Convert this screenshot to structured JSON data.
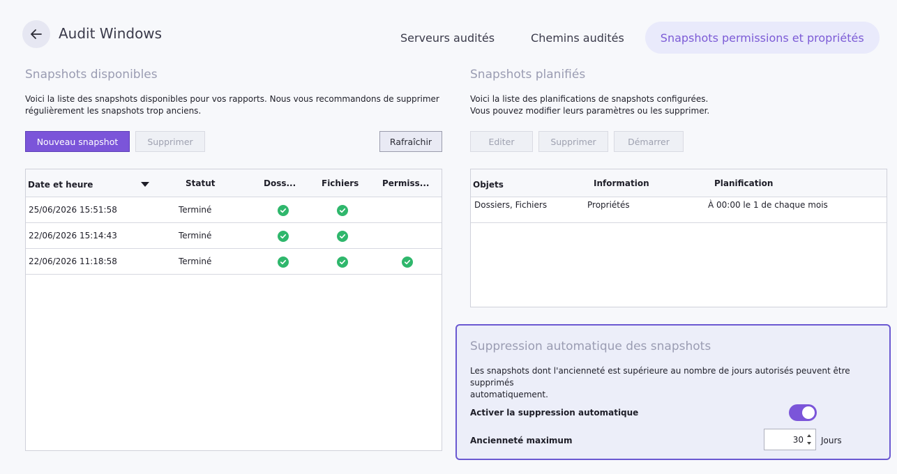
{
  "header": {
    "title": "Audit Windows",
    "tabs": [
      {
        "label": "Serveurs audités",
        "active": false
      },
      {
        "label": "Chemins audités",
        "active": false
      },
      {
        "label": "Snapshots permissions et propriétés",
        "active": true
      }
    ]
  },
  "snapshots": {
    "title": "Snapshots disponibles",
    "desc_line1": "Voici la liste des snapshots disponibles pour vos rapports. Nous vous recommandons de supprimer",
    "desc_line2": "régulièrement les snapshots trop anciens.",
    "btn_new": "Nouveau snapshot",
    "btn_delete": "Supprimer",
    "btn_refresh": "Rafraîchir",
    "columns": {
      "date": "Date et heure",
      "status": "Statut",
      "folders": "Doss...",
      "files": "Fichiers",
      "perms": "Permiss..."
    },
    "rows": [
      {
        "date": "25/06/2026 15:51:58",
        "status": "Terminé",
        "folders": true,
        "files": true,
        "perms": false
      },
      {
        "date": "22/06/2026 15:14:43",
        "status": "Terminé",
        "folders": true,
        "files": true,
        "perms": false
      },
      {
        "date": "22/06/2026 11:18:58",
        "status": "Terminé",
        "folders": true,
        "files": true,
        "perms": true
      }
    ]
  },
  "scheduled": {
    "title": "Snapshots planifiés",
    "desc_line1": "Voici la liste des planifications de snapshots configurées.",
    "desc_line2": "Vous pouvez modifier leurs paramètres ou les supprimer.",
    "btn_edit": "Editer",
    "btn_delete": "Supprimer",
    "btn_start": "Démarrer",
    "columns": {
      "objects": "Objets",
      "info": "Information",
      "schedule": "Planification"
    },
    "rows": [
      {
        "objects": "Dossiers, Fichiers",
        "info": "Propriétés",
        "schedule": "À 00:00 le 1 de chaque mois"
      }
    ]
  },
  "auto_delete": {
    "title": "Suppression automatique des snapshots",
    "desc_line1": "Les snapshots dont l'ancienneté est supérieure au nombre de jours autorisés peuvent être supprimés",
    "desc_line2": "automatiquement.",
    "enable_label": "Activer la suppression automatique",
    "enabled": true,
    "max_age_label": "Ancienneté maximum",
    "max_age_value": "30",
    "unit": "Jours"
  },
  "colors": {
    "accent": "#7b55d9",
    "success": "#2fb76c",
    "panel_border": "#6a58d1"
  }
}
